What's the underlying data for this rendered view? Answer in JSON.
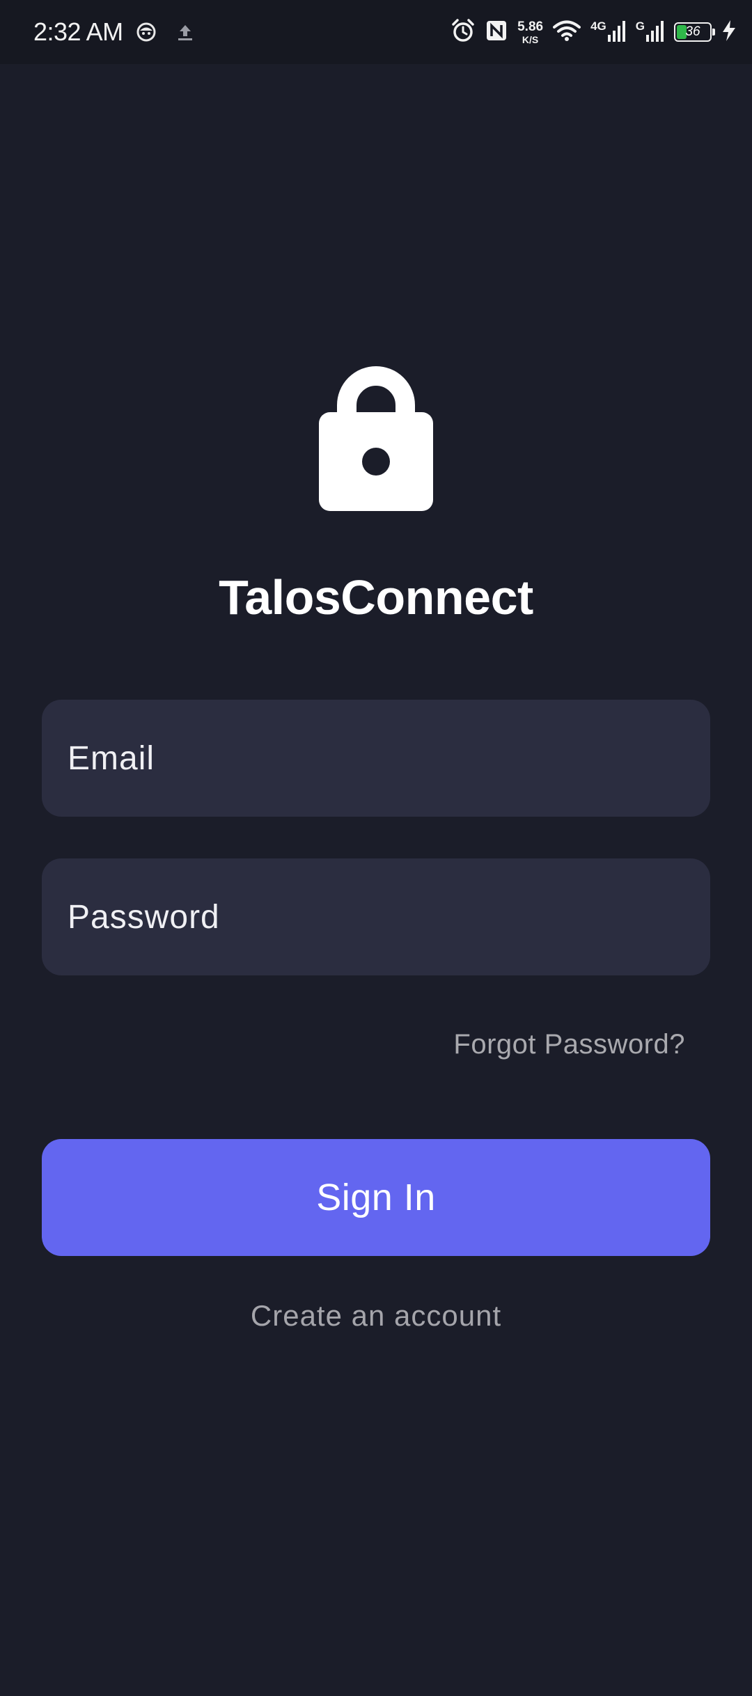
{
  "status_bar": {
    "time": "2:32 AM",
    "speed_value": "5.86",
    "speed_unit": "K/S",
    "network_1": "4G",
    "network_2": "G",
    "battery_percent": "36",
    "battery_level": 0.36,
    "icons_left": [
      "notification-face-icon",
      "upload-icon"
    ],
    "icons_right": [
      "alarm-icon",
      "nfc-icon",
      "wifi-icon",
      "signal-icon",
      "signal-icon",
      "battery-icon",
      "charging-bolt-icon"
    ]
  },
  "app": {
    "icon": "lock-icon",
    "title": "TalosConnect"
  },
  "form": {
    "email_placeholder": "Email",
    "email_value": "",
    "password_placeholder": "Password",
    "password_value": "",
    "forgot_label": "Forgot Password?",
    "signin_label": "Sign In",
    "create_label": "Create an account"
  },
  "colors": {
    "background": "#1b1d29",
    "status_bar": "#161821",
    "field": "#2b2d40",
    "accent": "#6366f0",
    "muted_text": "#a9a9ae",
    "battery": "#2fb84a"
  }
}
